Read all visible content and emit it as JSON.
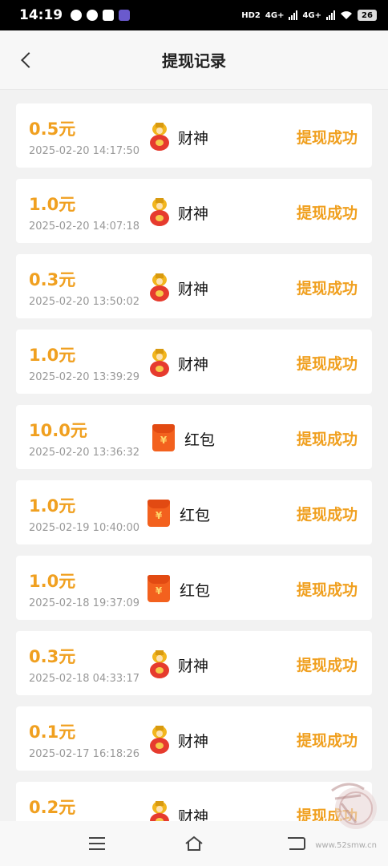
{
  "status_bar": {
    "time": "14:19",
    "hd": "HD2",
    "net1": "4G+",
    "net2": "4G+",
    "battery": "26"
  },
  "header": {
    "title": "提现记录",
    "back_icon": "chevron-left-icon"
  },
  "records": [
    {
      "amount": "0.5元",
      "time": "2025-02-20 14:17:50",
      "source": "财神",
      "icon": "caishen-icon",
      "status": "提现成功"
    },
    {
      "amount": "1.0元",
      "time": "2025-02-20 14:07:18",
      "source": "财神",
      "icon": "caishen-icon",
      "status": "提现成功"
    },
    {
      "amount": "0.3元",
      "time": "2025-02-20 13:50:02",
      "source": "财神",
      "icon": "caishen-icon",
      "status": "提现成功"
    },
    {
      "amount": "1.0元",
      "time": "2025-02-20 13:39:29",
      "source": "财神",
      "icon": "caishen-icon",
      "status": "提现成功"
    },
    {
      "amount": "10.0元",
      "time": "2025-02-20 13:36:32",
      "source": "红包",
      "icon": "hongbao-icon",
      "status": "提现成功"
    },
    {
      "amount": "1.0元",
      "time": "2025-02-19 10:40:00",
      "source": "红包",
      "icon": "hongbao-icon",
      "status": "提现成功"
    },
    {
      "amount": "1.0元",
      "time": "2025-02-18 19:37:09",
      "source": "红包",
      "icon": "hongbao-icon",
      "status": "提现成功"
    },
    {
      "amount": "0.3元",
      "time": "2025-02-18 04:33:17",
      "source": "财神",
      "icon": "caishen-icon",
      "status": "提现成功"
    },
    {
      "amount": "0.1元",
      "time": "2025-02-17 16:18:26",
      "source": "财神",
      "icon": "caishen-icon",
      "status": "提现成功"
    },
    {
      "amount": "0.2元",
      "time": "",
      "source": "财神",
      "icon": "caishen-icon",
      "status": "提现成功"
    }
  ],
  "hongbao_symbol": "¥",
  "watermark": "www.52smw.cn",
  "colors": {
    "accent": "#f0a020",
    "hongbao": "#f3611e"
  }
}
